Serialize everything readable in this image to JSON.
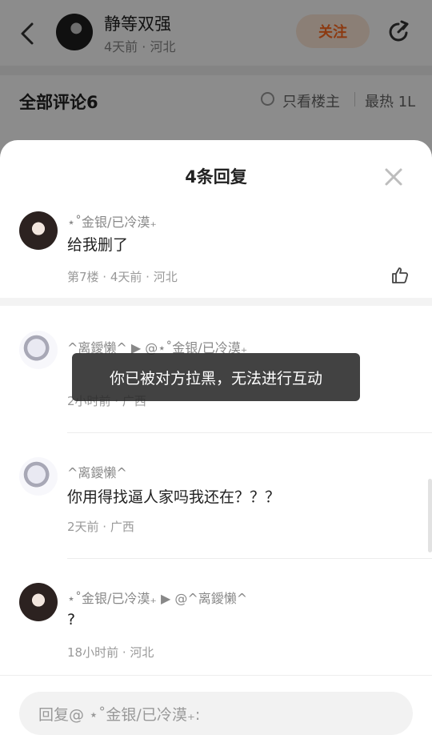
{
  "background_post": {
    "author_name": "静等双强",
    "author_meta": "4天前 · 河北",
    "follow_label": "关注",
    "comments_header": "全部评论6",
    "only_op_label": "只看楼主",
    "sort_label": "最热 1L"
  },
  "sheet": {
    "title": "4条回复",
    "replies": [
      {
        "user": "⋆˚金银/已冷漠₊",
        "text": "给我删了",
        "meta": "第7楼 · 4天前 · 河北"
      },
      {
        "user": "^离鑀懒^ ▶ @⋆˚金银/已冷漠₊",
        "text": "",
        "meta": "2小时前 · 广西"
      },
      {
        "user": "^离鑀懒^",
        "text": "你用得找逼人家吗我还在？？？",
        "meta": "2天前 · 广西"
      },
      {
        "user": "⋆˚金银/已冷漠₊ ▶ @^离鑀懒^",
        "text": "?",
        "meta": "18小时前 · 河北"
      }
    ]
  },
  "toast": "你已被对方拉黑，无法进行互动",
  "reply_input": {
    "placeholder": "回复@ ⋆˚金银/已冷漠₊:"
  },
  "icons": {
    "back": "chevron-left-icon",
    "share": "share-icon",
    "close": "close-icon",
    "like": "thumbs-up-icon"
  },
  "colors": {
    "accent": "#ff6b1f",
    "follow_bg": "#fde7d7"
  }
}
